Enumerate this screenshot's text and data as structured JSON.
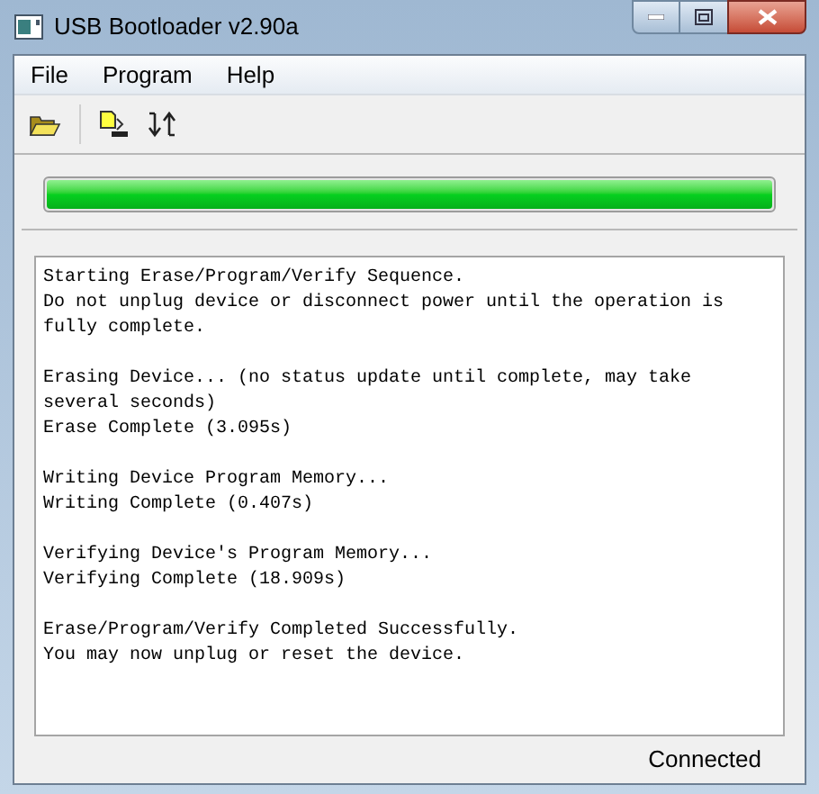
{
  "window": {
    "title": "USB Bootloader v2.90a"
  },
  "menu": [
    "File",
    "Program",
    "Help"
  ],
  "progress": {
    "level": 1
  },
  "log": [
    [
      "Starting Erase/Program/Verify Sequence.",
      "Do not unplug device or disconnect power until the operation is",
      "fully complete."
    ],
    [
      "Erasing Device... (no status update until complete, may take",
      "several seconds)",
      "Erase Complete (3.095s)"
    ],
    [
      "Writing Device Program Memory...",
      "Writing Complete (0.407s)"
    ],
    [
      "Verifying Device's Program Memory...",
      "Verifying Complete (18.909s)"
    ],
    [
      "Erase/Program/Verify Completed Successfully.",
      "You may now unplug or reset the device."
    ]
  ],
  "status_bar": "Connected"
}
